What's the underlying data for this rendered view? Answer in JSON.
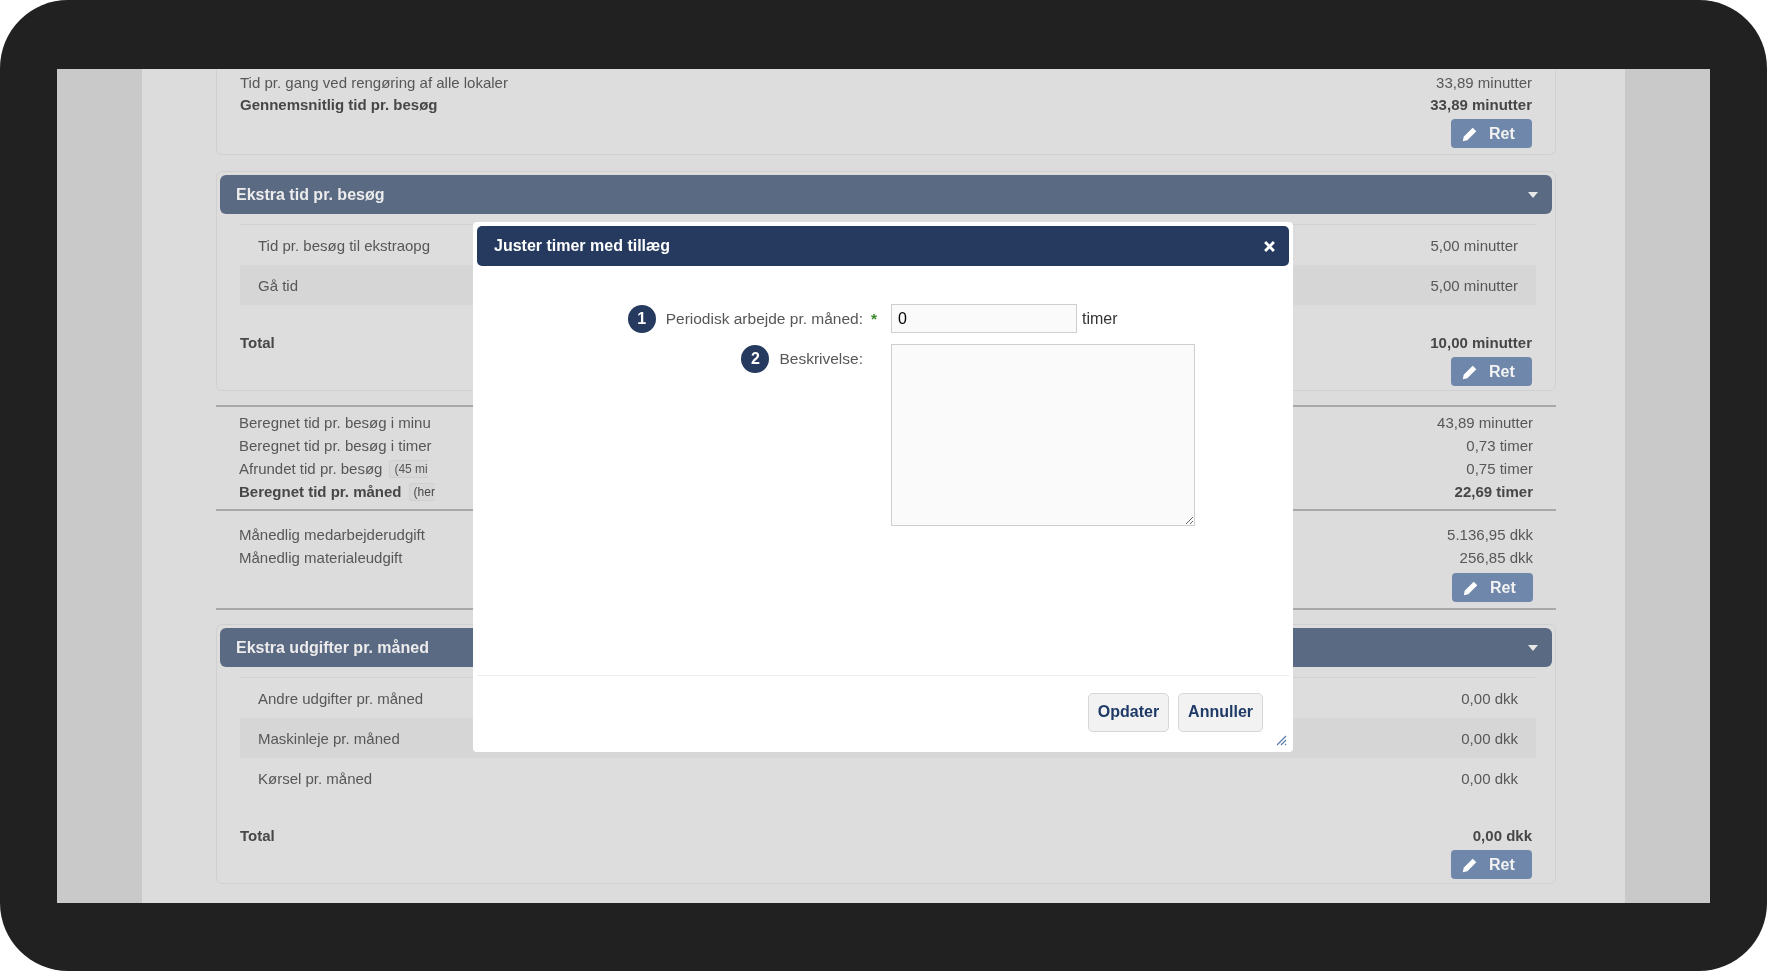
{
  "top_panel": {
    "rows": [
      {
        "label": "Tid pr. gang ved rengøring af alle lokaler",
        "value": "33,89 minutter",
        "bold": false
      },
      {
        "label": "Gennemsnitlig tid pr. besøg",
        "value": "33,89 minutter",
        "bold": true
      }
    ],
    "button": "Ret"
  },
  "extra_time": {
    "title": "Ekstra tid pr. besøg",
    "rows": [
      {
        "label": "Tid pr. besøg til ekstraopg",
        "value": "5,00 minutter"
      },
      {
        "label": "Gå tid",
        "value": "5,00 minutter"
      }
    ],
    "total_label": "Total",
    "total_value": "10,00 minutter",
    "button": "Ret"
  },
  "summary": [
    {
      "label": "Beregnet tid pr. besøg i minu",
      "value": "43,89 minutter",
      "bold": false
    },
    {
      "label": "Beregnet tid pr. besøg i timer",
      "value": "0,73 timer",
      "bold": false
    },
    {
      "label": "Afrundet tid pr. besøg",
      "note": "(45 mi",
      "value": "0,75 timer",
      "bold": false
    },
    {
      "label": "Beregnet tid pr. måned",
      "note": "(her",
      "value": "22,69 timer",
      "bold": true
    }
  ],
  "costs": {
    "rows": [
      {
        "label": "Månedlig medarbejderudgift",
        "value": "5.136,95 dkk"
      },
      {
        "label": "Månedlig materialeudgift",
        "value": "256,85 dkk"
      }
    ],
    "button": "Ret"
  },
  "extra_costs": {
    "title": "Ekstra udgifter pr. måned",
    "rows": [
      {
        "label": "Andre udgifter pr. måned",
        "value": "0,00 dkk"
      },
      {
        "label": "Maskinleje pr. måned",
        "value": "0,00 dkk"
      },
      {
        "label": "Kørsel pr. måned",
        "value": "0,00 dkk"
      }
    ],
    "total_label": "Total",
    "total_value": "0,00 dkk",
    "button": "Ret"
  },
  "dialog": {
    "title": "Juster timer med tillæg",
    "fields": [
      {
        "number": "1",
        "label": "Periodisk arbejde pr. måned:",
        "required_mark": "*",
        "kind": "input",
        "value": "0",
        "unit": "timer"
      },
      {
        "number": "2",
        "label": "Beskrivelse:",
        "kind": "textarea"
      }
    ],
    "buttons": [
      "Opdater",
      "Annuller"
    ]
  }
}
